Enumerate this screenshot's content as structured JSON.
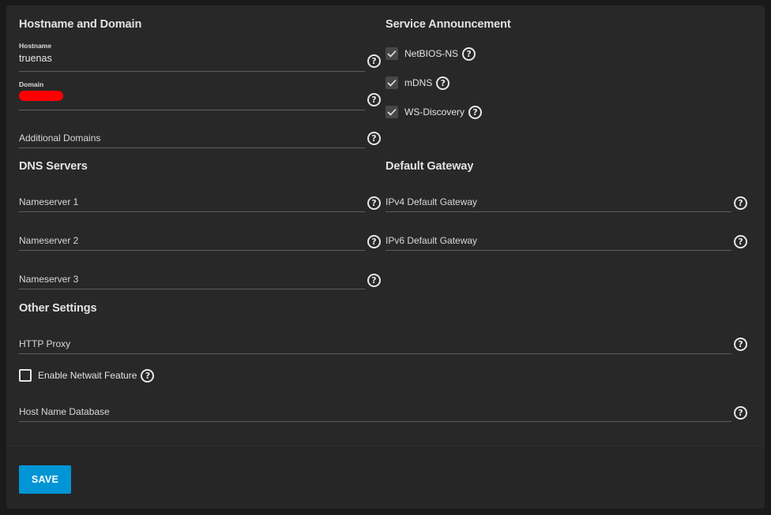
{
  "hostname_domain": {
    "title": "Hostname and Domain",
    "hostname_label": "Hostname",
    "hostname_value": "truenas",
    "domain_label": "Domain",
    "additional_domains_label": "Additional Domains"
  },
  "service_announcement": {
    "title": "Service Announcement",
    "items": [
      {
        "label": "NetBIOS-NS",
        "checked": true
      },
      {
        "label": "mDNS",
        "checked": true
      },
      {
        "label": "WS-Discovery",
        "checked": true
      }
    ]
  },
  "dns_servers": {
    "title": "DNS Servers",
    "nameserver1": "Nameserver 1",
    "nameserver2": "Nameserver 2",
    "nameserver3": "Nameserver 3"
  },
  "default_gateway": {
    "title": "Default Gateway",
    "ipv4": "IPv4 Default Gateway",
    "ipv6": "IPv6 Default Gateway"
  },
  "other_settings": {
    "title": "Other Settings",
    "http_proxy": "HTTP Proxy",
    "netwait_label": "Enable Netwait Feature",
    "netwait_checked": false,
    "host_name_db": "Host Name Database"
  },
  "actions": {
    "save_label": "SAVE"
  },
  "colors": {
    "accent": "#0095d5",
    "redaction": "#ff0000",
    "background": "#282828"
  },
  "icons": {
    "help": "help-circle-icon",
    "check": "check-icon"
  }
}
